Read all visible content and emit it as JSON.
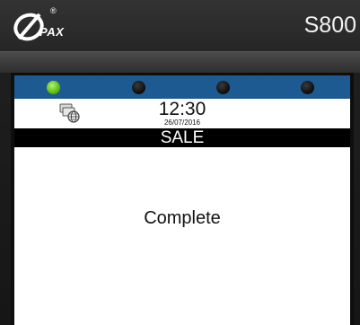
{
  "device": {
    "brand": "PAX",
    "registered_mark": "®",
    "model": "S800"
  },
  "leds": [
    {
      "state": "on",
      "color": "#5fc21a"
    },
    {
      "state": "off",
      "color": "#111111"
    },
    {
      "state": "off",
      "color": "#111111"
    },
    {
      "state": "off",
      "color": "#111111"
    }
  ],
  "status": {
    "network_icon": "network-globe-icon",
    "time": "12:30",
    "date": "26/07/2016"
  },
  "screen": {
    "title": "SALE",
    "message": "Complete"
  },
  "colors": {
    "led_bar": "#1e5a92",
    "title_bar": "#000000",
    "screen_bg": "#ffffff"
  }
}
